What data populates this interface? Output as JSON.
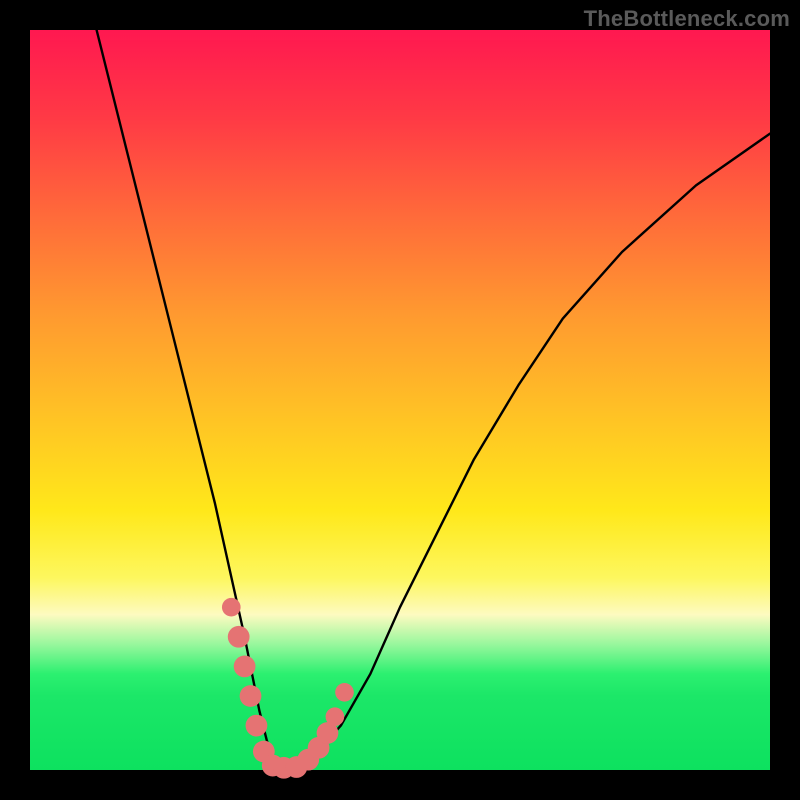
{
  "watermark": "TheBottleneck.com",
  "chart_data": {
    "type": "line",
    "title": "",
    "xlabel": "",
    "ylabel": "",
    "xlim": [
      0,
      100
    ],
    "ylim": [
      0,
      100
    ],
    "series": [
      {
        "name": "bottleneck-curve",
        "x": [
          9,
          11,
          13,
          15,
          17,
          19,
          21,
          23,
          25,
          27,
          29,
          30,
          31,
          32,
          33,
          34,
          36,
          38,
          42,
          46,
          50,
          55,
          60,
          66,
          72,
          80,
          90,
          100
        ],
        "y": [
          100,
          92,
          84,
          76,
          68,
          60,
          52,
          44,
          36,
          27,
          18,
          13,
          8,
          4,
          1.5,
          0.2,
          0.2,
          1.5,
          6,
          13,
          22,
          32,
          42,
          52,
          61,
          70,
          79,
          86
        ]
      }
    ],
    "markers": {
      "name": "highlighted-points",
      "color": "#e57373",
      "points": [
        {
          "x": 27.2,
          "y": 22,
          "r": 1.2
        },
        {
          "x": 28.2,
          "y": 18,
          "r": 1.4
        },
        {
          "x": 29.0,
          "y": 14,
          "r": 1.4
        },
        {
          "x": 29.8,
          "y": 10,
          "r": 1.4
        },
        {
          "x": 30.6,
          "y": 6,
          "r": 1.4
        },
        {
          "x": 31.6,
          "y": 2.5,
          "r": 1.4
        },
        {
          "x": 32.8,
          "y": 0.6,
          "r": 1.4
        },
        {
          "x": 34.3,
          "y": 0.3,
          "r": 1.4
        },
        {
          "x": 36.0,
          "y": 0.4,
          "r": 1.4
        },
        {
          "x": 37.6,
          "y": 1.4,
          "r": 1.4
        },
        {
          "x": 39.0,
          "y": 3.0,
          "r": 1.4
        },
        {
          "x": 40.2,
          "y": 5.0,
          "r": 1.4
        },
        {
          "x": 41.2,
          "y": 7.2,
          "r": 1.2
        },
        {
          "x": 42.5,
          "y": 10.5,
          "r": 1.2
        }
      ]
    }
  }
}
